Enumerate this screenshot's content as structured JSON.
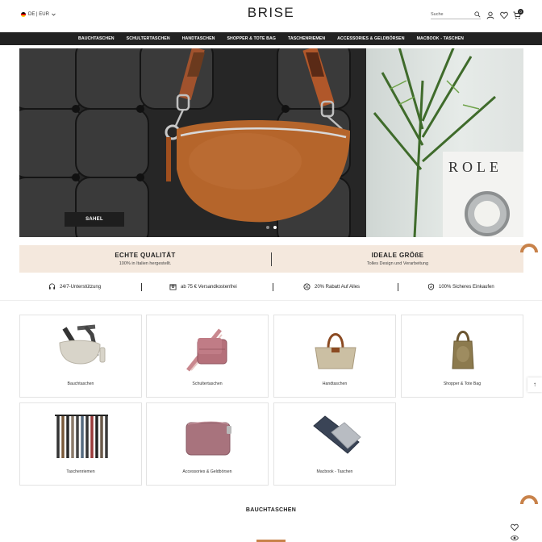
{
  "header": {
    "language": "DE",
    "currency": "EUR",
    "lang_label": "DE | EUR",
    "logo": "BRISE",
    "search_placeholder": "Suche",
    "cart_count": "0"
  },
  "nav": {
    "items": [
      "BAUCHTASCHEN",
      "SCHULTERTASCHEN",
      "HANDTASCHEN",
      "SHOPPER & TOTE BAG",
      "TASCHENRIEMEN",
      "ACCESSORIES & GELDBÖRSEN",
      "MACBOOK - TASCHEN"
    ]
  },
  "hero": {
    "button_label": "SAHEL",
    "watch_text": "ROLE",
    "slides_total": 2,
    "active_slide": 2
  },
  "band": {
    "left_title": "ECHTE QUALITÄT",
    "left_sub": "100% in Italien hergestellt.",
    "right_title": "IDEALE GRÖßE",
    "right_sub": "Tolles Design und Verarbeitung"
  },
  "features": [
    {
      "icon": "headset-icon",
      "label": "24/7-Unterstützung"
    },
    {
      "icon": "package-icon",
      "label": "ab 75 € Versandkostenfrei"
    },
    {
      "icon": "percent-icon",
      "label": "20% Rabatt Auf Alles"
    },
    {
      "icon": "shield-check-icon",
      "label": "100% Sicheres Einkaufen"
    }
  ],
  "categories": [
    {
      "label": "Bauchtaschen"
    },
    {
      "label": "Schultertaschen"
    },
    {
      "label": "Handtaschen"
    },
    {
      "label": "Shopper & Tote Bag"
    },
    {
      "label": "Taschenriemen"
    },
    {
      "label": "Accessories & Geldbörsen"
    },
    {
      "label": "Macbook - Taschen"
    }
  ],
  "section_title": "BAUCHTASCHEN",
  "colors": {
    "accent": "#c8824a",
    "nav_bg": "#222222",
    "band_bg": "#f4e8dd"
  }
}
